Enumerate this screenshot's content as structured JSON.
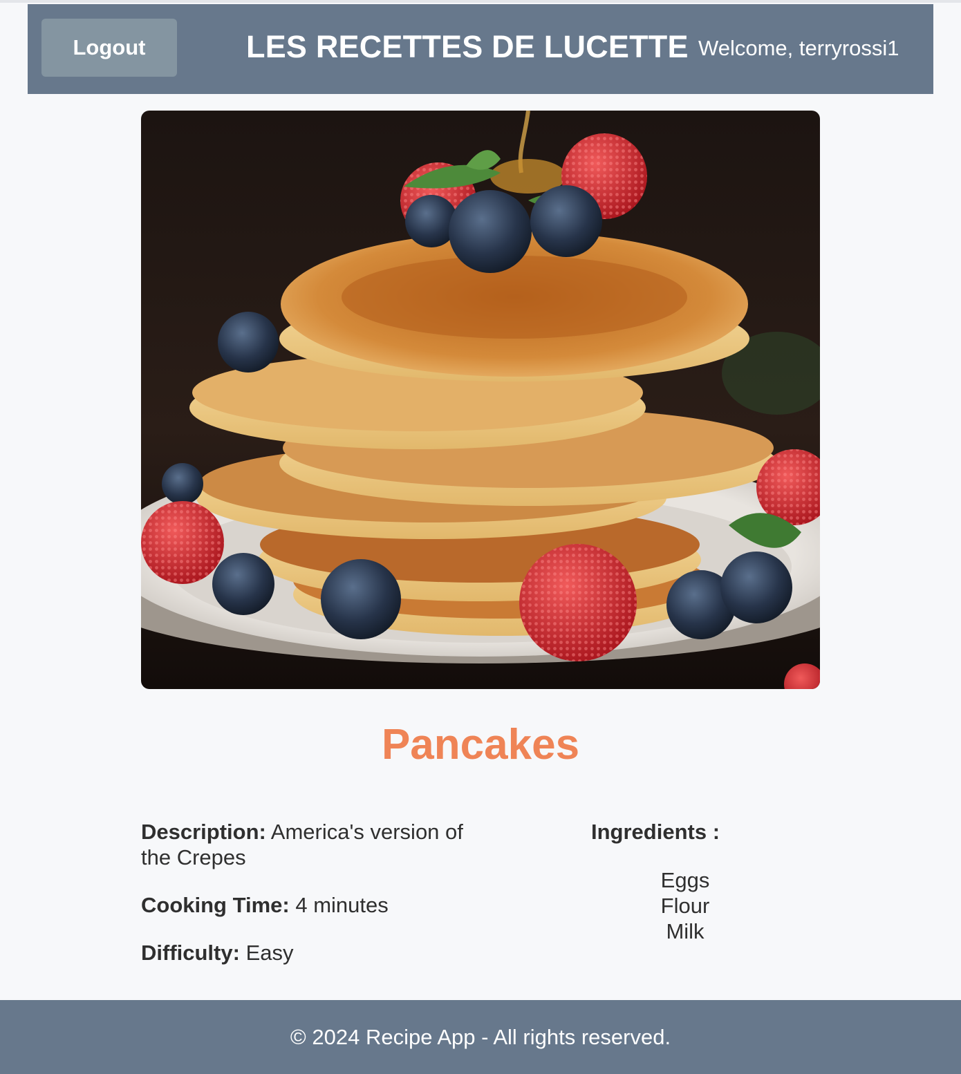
{
  "header": {
    "logout_label": "Logout",
    "site_title": "LES RECETTES DE LUCETTE",
    "welcome_text": "Welcome, terryrossi1"
  },
  "recipe": {
    "image_alt": "Pancakes",
    "title": "Pancakes",
    "description_label": "Description:",
    "description": "America's version of the Crepes",
    "cooking_time_label": "Cooking Time:",
    "cooking_time": "4 minutes",
    "difficulty_label": "Difficulty:",
    "difficulty": "Easy",
    "ingredients_label": "Ingredients :",
    "ingredients": [
      "Eggs",
      "Flour",
      "Milk"
    ]
  },
  "footer": {
    "text": "© 2024 Recipe App - All rights reserved."
  },
  "colors": {
    "header_bg": "#67788c",
    "logout_bg": "#8495a1",
    "recipe_title": "#ef8456",
    "page_bg": "#f7f8fa"
  }
}
